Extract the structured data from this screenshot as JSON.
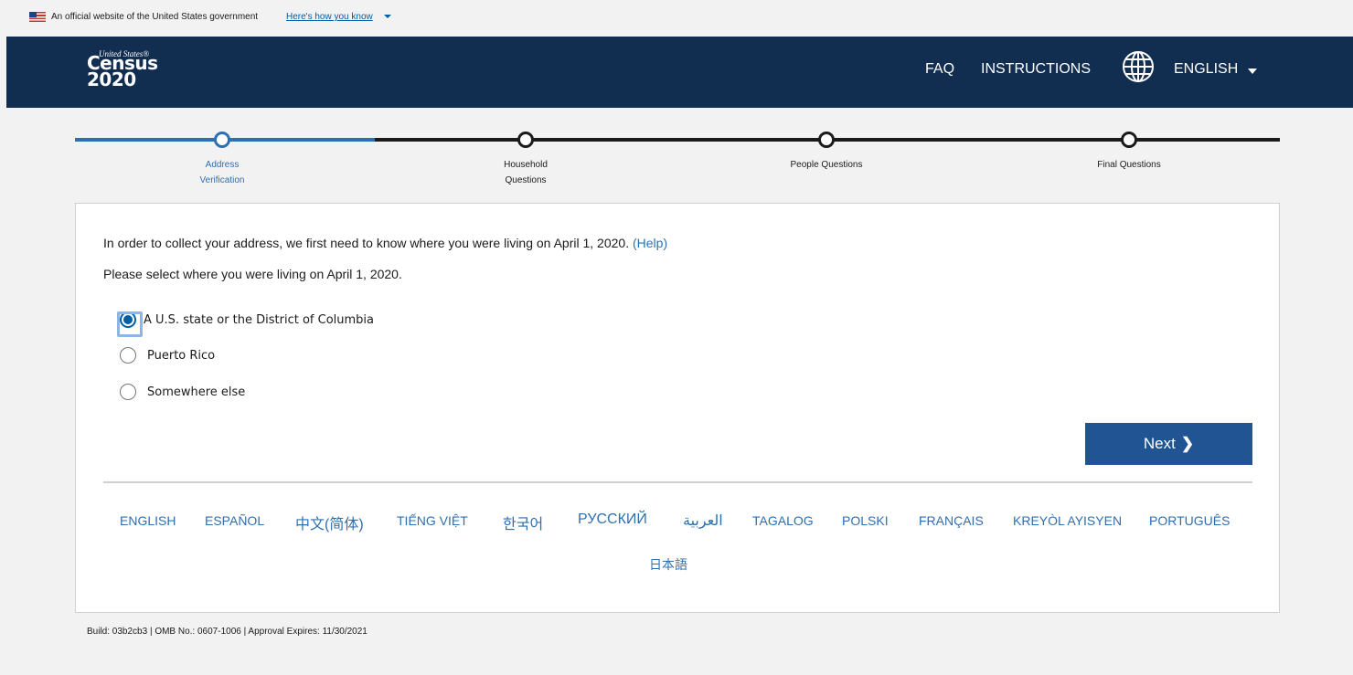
{
  "gov_banner": {
    "text": "An official website of the United States government",
    "link": "Here's how you know"
  },
  "header": {
    "logo_top": "United States®",
    "logo_word": "Census",
    "logo_year": "2020",
    "nav": {
      "faq": "FAQ",
      "instructions": "INSTRUCTIONS",
      "language": "ENGLISH"
    },
    "icons": [
      "globe-icon",
      "caret-down-icon"
    ]
  },
  "progress": {
    "steps": [
      {
        "label": "Address\nVerification",
        "current": true
      },
      {
        "label": "Household\nQuestions",
        "current": false
      },
      {
        "label": "People Questions",
        "current": false
      },
      {
        "label": "Final Questions",
        "current": false
      }
    ],
    "colors": {
      "done": "#2e6fb0",
      "todo": "#1b1b1b"
    }
  },
  "form": {
    "intro": "In order to collect your address, we first need to know where you were living on April 1, 2020.",
    "help_link": "(Help)",
    "question": "Please select where you were living on April 1, 2020.",
    "options": [
      {
        "label": "A U.S. state or the District of Columbia",
        "selected": true
      },
      {
        "label": "Puerto Rico",
        "selected": false
      },
      {
        "label": "Somewhere else",
        "selected": false
      }
    ],
    "next_button": "Next"
  },
  "languages": {
    "row1": [
      "ENGLISH",
      "ESPAÑOL",
      "中文(简体)",
      "TIẾNG VIỆT",
      "한국어",
      "РУССКИЙ",
      "العربية",
      "TAGALOG",
      "POLSKI",
      "FRANÇAIS",
      "KREYÒL AYISYEN",
      "PORTUGUÊS"
    ],
    "row2": [
      "日本語"
    ]
  },
  "footer": {
    "build": "Build: 03b2cb3",
    "omb": "OMB No.: 0607-1006",
    "approval": "Approval Expires: 11/30/2021",
    "full": "Build: 03b2cb3 | OMB No.: 0607-1006 | Approval Expires: 11/30/2021"
  },
  "theme": {
    "header_bg": "#112e51",
    "accent": "#2e6fb0",
    "button_bg": "#205493"
  }
}
